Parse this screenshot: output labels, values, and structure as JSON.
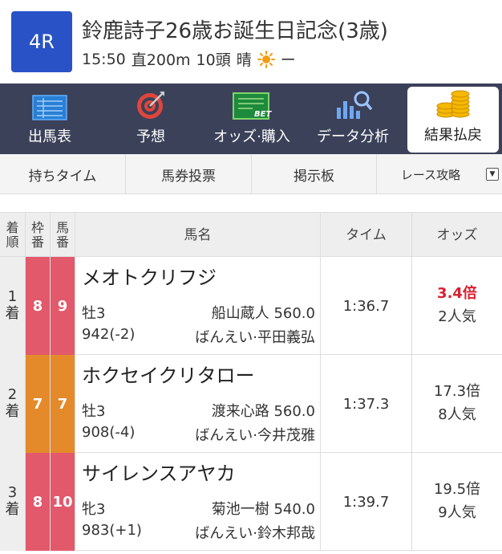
{
  "race": {
    "number": "4R",
    "title": "鈴鹿詩子26歳お誕生日記念(3歳)",
    "time": "15:50",
    "course": "直200m",
    "field_size": "10頭",
    "weather": "晴",
    "weather_icon": "sun-icon",
    "track": "ー"
  },
  "nav": {
    "items": [
      {
        "label": "出馬表",
        "icon": "entry-table-icon"
      },
      {
        "label": "予想",
        "icon": "target-icon"
      },
      {
        "label": "オッズ·購入",
        "icon": "bet-ticket-icon"
      },
      {
        "label": "データ分析",
        "icon": "bar-chart-magnifier-icon"
      },
      {
        "label": "結果払戻",
        "icon": "coins-icon",
        "active": true
      }
    ]
  },
  "subnav": {
    "items": [
      "持ちタイム",
      "馬券投票",
      "掲示板",
      "レース攻略"
    ]
  },
  "table": {
    "headers": {
      "rank": [
        "着",
        "順"
      ],
      "waku": [
        "枠",
        "番"
      ],
      "umaban": [
        "馬",
        "番"
      ],
      "horse": "馬名",
      "time": "タイム",
      "odds": "オッズ"
    },
    "rows": [
      {
        "rank": "1",
        "rank_suffix": "着",
        "waku": "8",
        "umaban": "9",
        "waku_color": "#e2596c",
        "name": "メオトクリフジ",
        "sex_age": "牡3",
        "jockey_weight": "船山蔵人 560.0",
        "weight": "942(-2)",
        "trainer": "ばんえい·平田義弘",
        "time": "1:36.7",
        "odds": "3.4倍",
        "popularity": "2人気",
        "odds_highlight": true
      },
      {
        "rank": "2",
        "rank_suffix": "着",
        "waku": "7",
        "umaban": "7",
        "waku_color": "#e48a2a",
        "name": "ホクセイクリタロー",
        "sex_age": "牡3",
        "jockey_weight": "渡来心路 560.0",
        "weight": "908(-4)",
        "trainer": "ばんえい·今井茂雅",
        "time": "1:37.3",
        "odds": "17.3倍",
        "popularity": "8人気",
        "odds_highlight": false
      },
      {
        "rank": "3",
        "rank_suffix": "着",
        "waku": "8",
        "umaban": "10",
        "waku_color": "#e2596c",
        "name": "サイレンスアヤカ",
        "sex_age": "牝3",
        "jockey_weight": "菊池一樹 540.0",
        "weight": "983(+1)",
        "trainer": "ばんえい·鈴木邦哉",
        "time": "1:39.7",
        "odds": "19.5倍",
        "popularity": "9人気",
        "odds_highlight": false
      }
    ]
  }
}
